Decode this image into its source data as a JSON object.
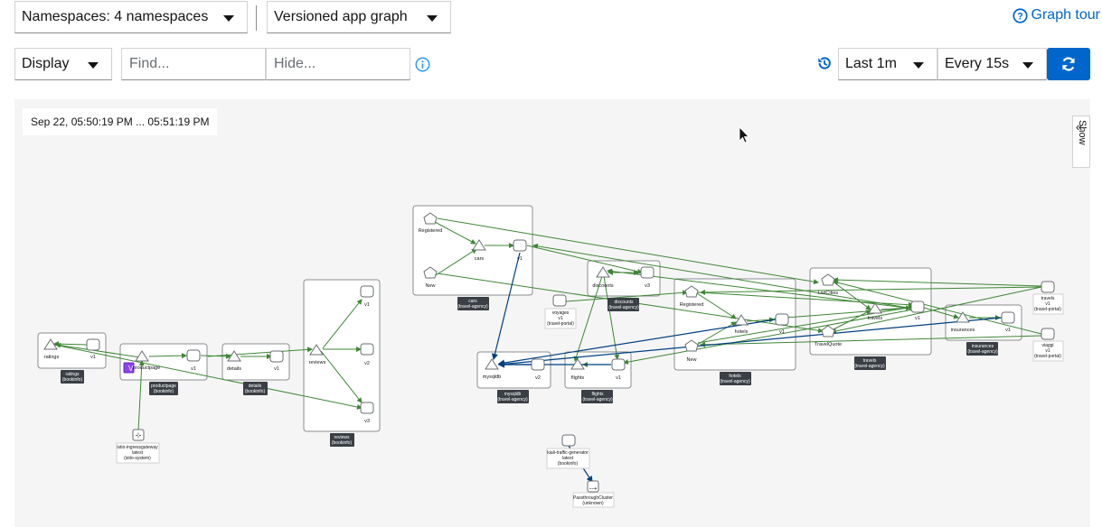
{
  "toolbar": {
    "namespaces_label": "Namespaces: 4 namespaces",
    "graph_type_label": "Versioned app graph",
    "graph_tour_label": "Graph tour",
    "display_label": "Display",
    "find_placeholder": "Find...",
    "hide_placeholder": "Hide...",
    "duration_label": "Last 1m",
    "refresh_interval_label": "Every 15s"
  },
  "graph": {
    "time_range": "Sep 22, 05:50:19 PM ... 05:51:19 PM",
    "show_label": "Show",
    "groups": {
      "ratings": [
        "ratings",
        "(bookinfo)"
      ],
      "productpage": [
        "productpage",
        "(bookinfo)"
      ],
      "details": [
        "details",
        "(bookinfo)"
      ],
      "reviews": [
        "reviews",
        "(bookinfo)"
      ],
      "cars": [
        "cars",
        "(travel-agency)"
      ],
      "mysqldb": [
        "mysqldb",
        "(travel-agency)"
      ],
      "flights": [
        "flights",
        "(travel-agency)"
      ],
      "discounts": [
        "discounts",
        "(travel-agency)"
      ],
      "hotels": [
        "hotels",
        "(travel-agency)"
      ],
      "travels": [
        "travels",
        "(travel-agency)"
      ],
      "insurances": [
        "insurances",
        "(travel-agency)"
      ]
    },
    "nodes": {
      "ratings": "ratings",
      "v1": "v1",
      "v2": "v2",
      "v3": "v3",
      "productpage": "productpage",
      "details": "details",
      "reviews": "reviews",
      "registered": "Registered",
      "new": "New",
      "cars": "cars",
      "mysqldb": "mysqldb",
      "flights": "flights",
      "discounts": "discounts",
      "hotels": "hotels",
      "travels": "travels",
      "listcities": "ListCities",
      "travelquote": "TravelQuote",
      "insurances": "insurances",
      "voyages": [
        "voyages",
        "v1",
        "(travel-portal)"
      ],
      "travels_portal": [
        "travels",
        "v1",
        "(travel-portal)"
      ],
      "viaggi": [
        "viaggi",
        "v1",
        "(travel-portal)"
      ],
      "ingress": [
        "istio-ingressgateway",
        "latest",
        "(istio-system)"
      ],
      "kiali_traffic": [
        "kiali-traffic-generator",
        "latest",
        "(bookinfo)"
      ],
      "passthrough": [
        "PassthroughCluster",
        "(unknown)"
      ]
    }
  }
}
